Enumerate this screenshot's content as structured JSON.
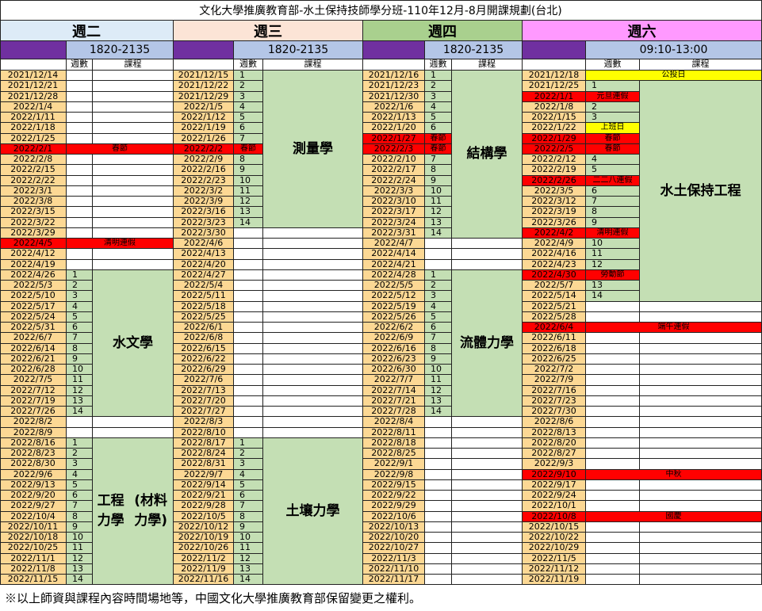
{
  "title": "文化大學推廣教育部-水土保持技師學分班-110年12月-8月開課規劃(台北)",
  "footer": "※以上師資與課程內容時間場地等，中國文化大學推廣教育部保留變更之權利。",
  "sub_headers": {
    "week": "週數",
    "course": "課程"
  },
  "colors": {
    "tan": "#fcd894",
    "green": "#c4dfb4",
    "red": "#ff0000",
    "yellow": "#ffff00",
    "white": "#ffffff",
    "purple": "#7030a0",
    "time_blue": "#b4c6e7",
    "tue_head": "#ddebf7",
    "wed_head": "#fce4d6",
    "thu_head": "#a9d08e",
    "sat_head": "#ff99ff"
  },
  "days": [
    {
      "name": "週二",
      "time": "1820-2135",
      "head_color": "tue_head",
      "dates": [
        "2021/12/14",
        "2021/12/21",
        "2021/12/28",
        "2022/1/4",
        "2022/1/11",
        "2022/1/18",
        "2022/1/25",
        "2022/2/1",
        "2022/2/8",
        "2022/2/15",
        "2022/2/22",
        "2022/3/1",
        "2022/3/8",
        "2022/3/15",
        "2022/3/22",
        "2022/3/29",
        "2022/4/5",
        "2022/4/12",
        "2022/4/19",
        "2022/4/26",
        "2022/5/3",
        "2022/5/10",
        "2022/5/17",
        "2022/5/24",
        "2022/5/31",
        "2022/6/7",
        "2022/6/14",
        "2022/6/21",
        "2022/6/28",
        "2022/7/5",
        "2022/7/12",
        "2022/7/19",
        "2022/7/26",
        "2022/8/2",
        "2022/8/9",
        "2022/8/16",
        "2022/8/23",
        "2022/8/30",
        "2022/9/6",
        "2022/9/13",
        "2022/9/20",
        "2022/9/27",
        "2022/10/4",
        "2022/10/11",
        "2022/10/18",
        "2022/10/25",
        "2022/11/1",
        "2022/11/8",
        "2022/11/15"
      ],
      "weeks": [
        "",
        "",
        "",
        "",
        "",
        "",
        "",
        "",
        "",
        "",
        "",
        "",
        "",
        "",
        "",
        "",
        "",
        "",
        "",
        "1",
        "2",
        "3",
        "4",
        "5",
        "6",
        "7",
        "8",
        "9",
        "10",
        "11",
        "12",
        "13",
        "14",
        "",
        "",
        "1",
        "2",
        "3",
        "4",
        "5",
        "6",
        "7",
        "8",
        "9",
        "10",
        "11",
        "12",
        "13",
        "14"
      ],
      "notes": [
        {
          "row": 7,
          "span": "full",
          "text": "春節"
        },
        {
          "row": 16,
          "span": "full",
          "text": "清明連假"
        }
      ],
      "blocks": [
        {
          "start": 19,
          "end": 32,
          "text": "水文學"
        },
        {
          "start": 35,
          "end": 48,
          "text": "工程力學(材料力學)"
        }
      ]
    },
    {
      "name": "週三",
      "time": "1820-2135",
      "head_color": "wed_head",
      "dates": [
        "2021/12/15",
        "2021/12/22",
        "2021/12/29",
        "2022/1/5",
        "2022/1/12",
        "2022/1/19",
        "2022/1/26",
        "2022/2/2",
        "2022/2/9",
        "2022/2/16",
        "2022/2/23",
        "2022/3/2",
        "2022/3/9",
        "2022/3/16",
        "2022/3/23",
        "2022/3/30",
        "2022/4/6",
        "2022/4/13",
        "2022/4/20",
        "2022/4/27",
        "2022/5/4",
        "2022/5/11",
        "2022/5/18",
        "2022/5/25",
        "2022/6/1",
        "2022/6/8",
        "2022/6/15",
        "2022/6/22",
        "2022/6/29",
        "2022/7/6",
        "2022/7/13",
        "2022/7/20",
        "2022/7/27",
        "2022/8/3",
        "2022/8/10",
        "2022/8/17",
        "2022/8/24",
        "2022/8/31",
        "2022/9/7",
        "2022/9/14",
        "2022/9/21",
        "2022/9/28",
        "2022/10/5",
        "2022/10/12",
        "2022/10/19",
        "2022/10/26",
        "2022/11/2",
        "2022/11/9",
        "2022/11/16"
      ],
      "weeks": [
        "1",
        "2",
        "3",
        "4",
        "5",
        "6",
        "7",
        "",
        "8",
        "9",
        "10",
        "11",
        "12",
        "13",
        "14",
        "",
        "",
        "",
        "",
        "",
        "",
        "",
        "",
        "",
        "",
        "",
        "",
        "",
        "",
        "",
        "",
        "",
        "",
        "",
        "",
        "1",
        "2",
        "3",
        "4",
        "5",
        "6",
        "7",
        "8",
        "9",
        "10",
        "11",
        "12",
        "13",
        "14"
      ],
      "notes": [
        {
          "row": 7,
          "span": "week",
          "text": "春節"
        }
      ],
      "blocks": [
        {
          "start": 0,
          "end": 14,
          "text": "測量學"
        },
        {
          "start": 35,
          "end": 48,
          "text": "土壤力學"
        }
      ]
    },
    {
      "name": "週四",
      "time": "1820-2135",
      "head_color": "thu_head",
      "dates": [
        "2021/12/16",
        "2021/12/23",
        "2021/12/30",
        "2022/1/6",
        "2022/1/13",
        "2022/1/20",
        "2022/1/27",
        "2022/2/3",
        "2022/2/10",
        "2022/2/17",
        "2022/2/24",
        "2022/3/3",
        "2022/3/10",
        "2022/3/17",
        "2022/3/24",
        "2022/3/31",
        "2022/4/7",
        "2022/4/14",
        "2022/4/21",
        "2022/4/28",
        "2022/5/5",
        "2022/5/12",
        "2022/5/19",
        "2022/5/26",
        "2022/6/2",
        "2022/6/9",
        "2022/6/16",
        "2022/6/23",
        "2022/6/30",
        "2022/7/7",
        "2022/7/14",
        "2022/7/21",
        "2022/7/28",
        "2022/8/4",
        "2022/8/11",
        "2022/8/18",
        "2022/8/25",
        "2022/9/1",
        "2022/9/8",
        "2022/9/15",
        "2022/9/22",
        "2022/9/29",
        "2022/10/6",
        "2022/10/13",
        "2022/10/20",
        "2022/10/27",
        "2022/11/3",
        "2022/11/10",
        "2022/11/17"
      ],
      "weeks": [
        "1",
        "2",
        "3",
        "4",
        "5",
        "6",
        "",
        "",
        "7",
        "8",
        "9",
        "10",
        "11",
        "12",
        "13",
        "14",
        "",
        "",
        "",
        "1",
        "2",
        "3",
        "4",
        "5",
        "6",
        "7",
        "8",
        "9",
        "10",
        "11",
        "12",
        "13",
        "14",
        "",
        "",
        "",
        "",
        "",
        "",
        "",
        "",
        "",
        "",
        "",
        "",
        "",
        "",
        "",
        ""
      ],
      "notes": [
        {
          "row": 6,
          "span": "week",
          "text": "春節"
        },
        {
          "row": 7,
          "span": "week",
          "text": "春節"
        }
      ],
      "blocks": [
        {
          "start": 0,
          "end": 15,
          "text": "結構學"
        },
        {
          "start": 19,
          "end": 32,
          "text": "流體力學"
        }
      ]
    },
    {
      "name": "週六",
      "time": "09:10-13:00",
      "head_color": "sat_head",
      "dates": [
        "2021/12/18",
        "2021/12/25",
        "2022/1/1",
        "2022/1/8",
        "2022/1/15",
        "2022/1/22",
        "2022/1/29",
        "2022/2/5",
        "2022/2/12",
        "2022/2/19",
        "2022/2/26",
        "2022/3/5",
        "2022/3/12",
        "2022/3/19",
        "2022/3/26",
        "2022/4/2",
        "2022/4/9",
        "2022/4/16",
        "2022/4/23",
        "2022/4/30",
        "2022/5/7",
        "2022/5/14",
        "2022/5/21",
        "2022/5/28",
        "2022/6/4",
        "2022/6/11",
        "2022/6/18",
        "2022/6/25",
        "2022/7/2",
        "2022/7/9",
        "2022/7/16",
        "2022/7/23",
        "2022/7/30",
        "2022/8/6",
        "2022/8/13",
        "2022/8/20",
        "2022/8/27",
        "2022/9/3",
        "2022/9/10",
        "2022/9/17",
        "2022/9/24",
        "2022/10/1",
        "2022/10/8",
        "2022/10/15",
        "2022/10/22",
        "2022/10/29",
        "2022/11/5",
        "2022/11/12",
        "2022/11/19"
      ],
      "weeks": [
        "",
        "1",
        "",
        "2",
        "3",
        "",
        "",
        "",
        "4",
        "5",
        "",
        "6",
        "7",
        "8",
        "9",
        "",
        "10",
        "11",
        "12",
        "",
        "13",
        "14",
        "",
        "",
        "",
        "",
        "",
        "",
        "",
        "",
        "",
        "",
        "",
        "",
        "",
        "",
        "",
        "",
        "",
        "",
        "",
        "",
        "",
        "",
        "",
        "",
        "",
        "",
        ""
      ],
      "notes": [
        {
          "row": 0,
          "span": "full",
          "text": "公投日",
          "color": "yellow"
        },
        {
          "row": 2,
          "span": "week",
          "text": "元旦連假"
        },
        {
          "row": 5,
          "span": "week",
          "text": "上班日",
          "color": "yellow"
        },
        {
          "row": 6,
          "span": "week",
          "text": "春節"
        },
        {
          "row": 7,
          "span": "week",
          "text": "春節"
        },
        {
          "row": 10,
          "span": "week",
          "text": "二二八連假"
        },
        {
          "row": 15,
          "span": "week",
          "text": "清明連假"
        },
        {
          "row": 19,
          "span": "week",
          "text": "勞動節"
        },
        {
          "row": 24,
          "span": "full",
          "text": "端午連假"
        },
        {
          "row": 38,
          "span": "full",
          "text": "中秋"
        },
        {
          "row": 42,
          "span": "full",
          "text": "國慶"
        }
      ],
      "blocks": [
        {
          "start": 1,
          "end": 21,
          "text": "水土保持工程"
        }
      ]
    }
  ]
}
